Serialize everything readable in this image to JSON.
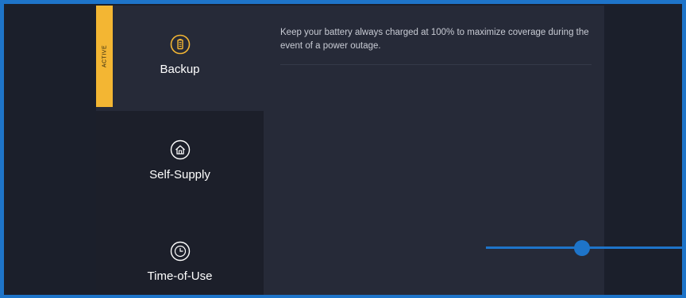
{
  "modes": [
    {
      "label": "Backup",
      "active": true,
      "tab_text": "ACTIVE",
      "icon": "battery-icon"
    },
    {
      "label": "Self-Supply",
      "active": false,
      "icon": "home-icon"
    },
    {
      "label": "Time-of-Use",
      "active": false,
      "icon": "clock-icon"
    }
  ],
  "content": {
    "description": "Keep your battery always charged at 100% to maximize coverage during the event of a power outage."
  },
  "colors": {
    "accent": "#f3b633",
    "frame": "#1e74c9",
    "panel": "#262a38",
    "inactive_tile": "#1c1f2a"
  }
}
